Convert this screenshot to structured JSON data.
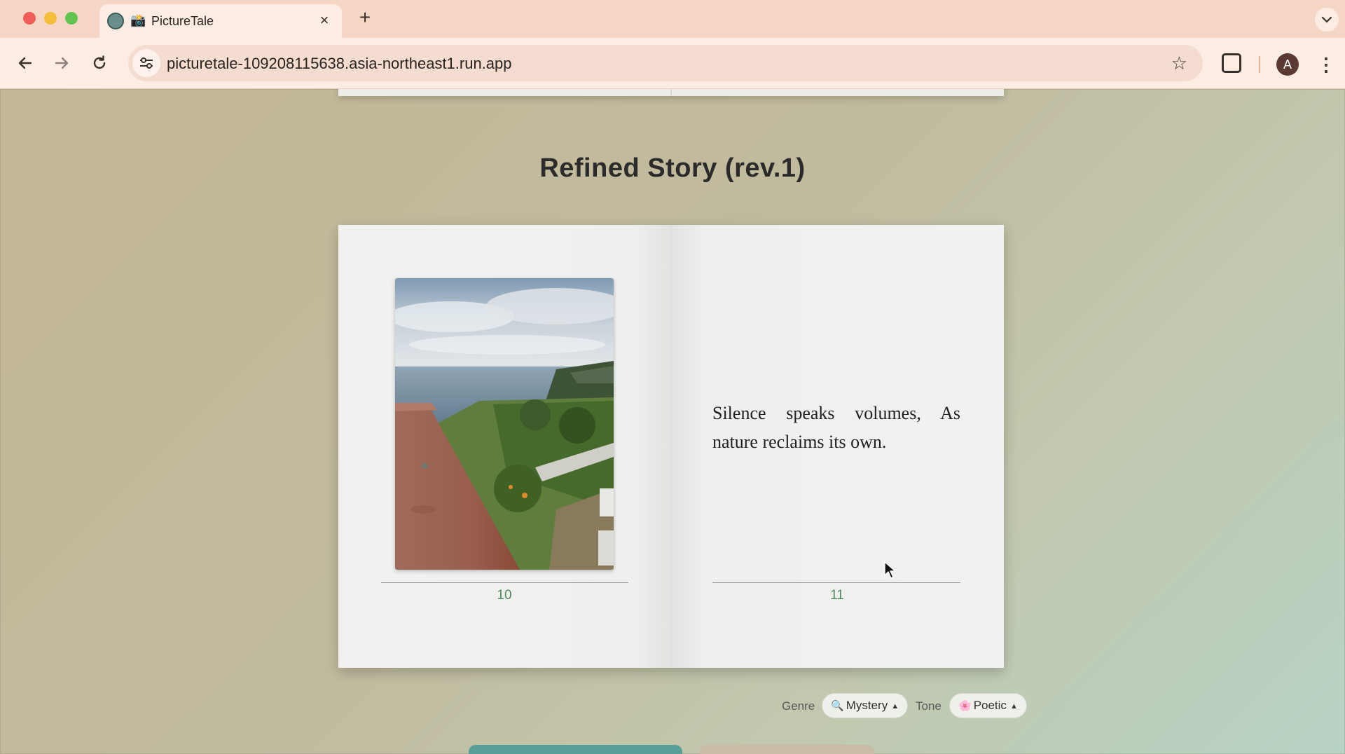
{
  "browser": {
    "tab": {
      "emoji": "📸",
      "title": "PictureTale",
      "close_glyph": "×"
    },
    "new_tab_glyph": "+",
    "tab_search_glyph": "⌄",
    "url": "picturetale-109208115638.asia-northeast1.run.app",
    "avatar_initial": "A",
    "icons": [
      "back-arrow-icon",
      "forward-arrow-icon",
      "reload-icon",
      "site-info-icon",
      "star-icon",
      "extensions-icon",
      "more-menu-icon"
    ]
  },
  "story": {
    "section_title": "Refined Story (rev.1)",
    "left_page": {
      "number": "10",
      "image_alt": "Coastal hillside with rusty wall overlooking the sea"
    },
    "right_page": {
      "number": "11",
      "text": "Silence speaks volumes, As nature reclaims its own."
    }
  },
  "controls": {
    "genre_label": "Genre",
    "genre": {
      "icon": "🔍",
      "value": "Mystery",
      "caret": "▲"
    },
    "tone_label": "Tone",
    "tone": {
      "icon": "🌸",
      "value": "Poetic",
      "caret": "▲"
    }
  },
  "colors": {
    "tabbar": "#f6d6c4",
    "page_number": "#4f8a5e",
    "primary_button": "#5a9e98"
  }
}
